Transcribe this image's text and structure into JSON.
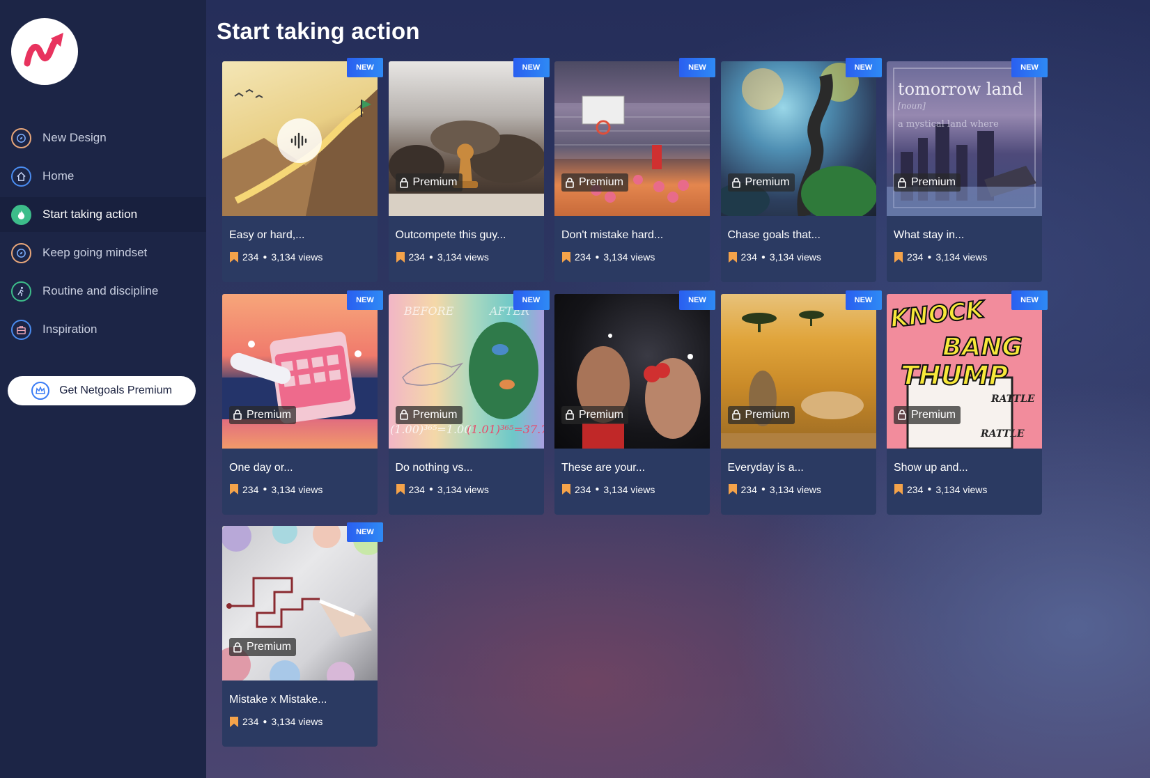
{
  "sidebar": {
    "logo_icon": "netgoals-logo-icon",
    "items": [
      {
        "label": "New Design",
        "icon": "compass-icon",
        "color": "#e9a77a",
        "active": false
      },
      {
        "label": "Home",
        "icon": "home-icon",
        "color": "#4a8cf0",
        "active": false
      },
      {
        "label": "Start taking action",
        "icon": "flame-icon",
        "color": "#3dbd8a",
        "active": true
      },
      {
        "label": "Keep going mindset",
        "icon": "compass-icon",
        "color": "#e9a77a",
        "active": false
      },
      {
        "label": "Routine and discipline",
        "icon": "runner-icon",
        "color": "#3dbd8a",
        "active": false
      },
      {
        "label": "Inspiration",
        "icon": "briefcase-icon",
        "color": "#4a8cf0",
        "active": false
      }
    ],
    "premium_button": "Get Netgoals Premium"
  },
  "page_title": "Start taking action",
  "badge_new": "NEW",
  "premium_label": "Premium",
  "bookmark_color": "#f5a34a",
  "cards": [
    {
      "title": "Easy or hard,...",
      "saves": "234",
      "views": "3,134 views",
      "premium": false,
      "image": "desert-climb-illustration"
    },
    {
      "title": "Outcompete this guy...",
      "saves": "234",
      "views": "3,134 views",
      "premium": true,
      "image": "chess-pieces"
    },
    {
      "title": "Don't mistake hard...",
      "saves": "234",
      "views": "3,134 views",
      "premium": true,
      "image": "basketball-court"
    },
    {
      "title": "Chase goals that...",
      "saves": "234",
      "views": "3,134 views",
      "premium": true,
      "image": "spiral-tower-fantasy"
    },
    {
      "title": "What stay in...",
      "saves": "234",
      "views": "3,134 views",
      "premium": true,
      "image": "tomorrow-land-city"
    },
    {
      "title": "One day or...",
      "saves": "234",
      "views": "3,134 views",
      "premium": true,
      "image": "calendar-3d"
    },
    {
      "title": "Do nothing vs...",
      "saves": "234",
      "views": "3,134 views",
      "premium": true,
      "image": "before-after-birds"
    },
    {
      "title": "These are your...",
      "saves": "234",
      "views": "3,134 views",
      "premium": true,
      "image": "boxers"
    },
    {
      "title": "Everyday is a...",
      "saves": "234",
      "views": "3,134 views",
      "premium": true,
      "image": "cheetah-gazelle"
    },
    {
      "title": "Show up and...",
      "saves": "234",
      "views": "3,134 views",
      "premium": true,
      "image": "comic-knock-bang"
    },
    {
      "title": "Mistake x Mistake...",
      "saves": "234",
      "views": "3,134 views",
      "premium": true,
      "image": "maze-drawing"
    }
  ],
  "thumb_text": {
    "tomorrow_land": "tomorrow land",
    "noun": "[noun]",
    "mystical": "a mystical land where",
    "before": "BEFORE",
    "after": "AFTER",
    "formula_left": "(1.00)³⁶⁵=1.00",
    "formula_right": "(1.01)³⁶⁵=37.7",
    "knock": "KNOCK",
    "bang": "BANG",
    "thump": "THUMP",
    "rattle1": "RATTLE",
    "rattle2": "RATTLE"
  }
}
